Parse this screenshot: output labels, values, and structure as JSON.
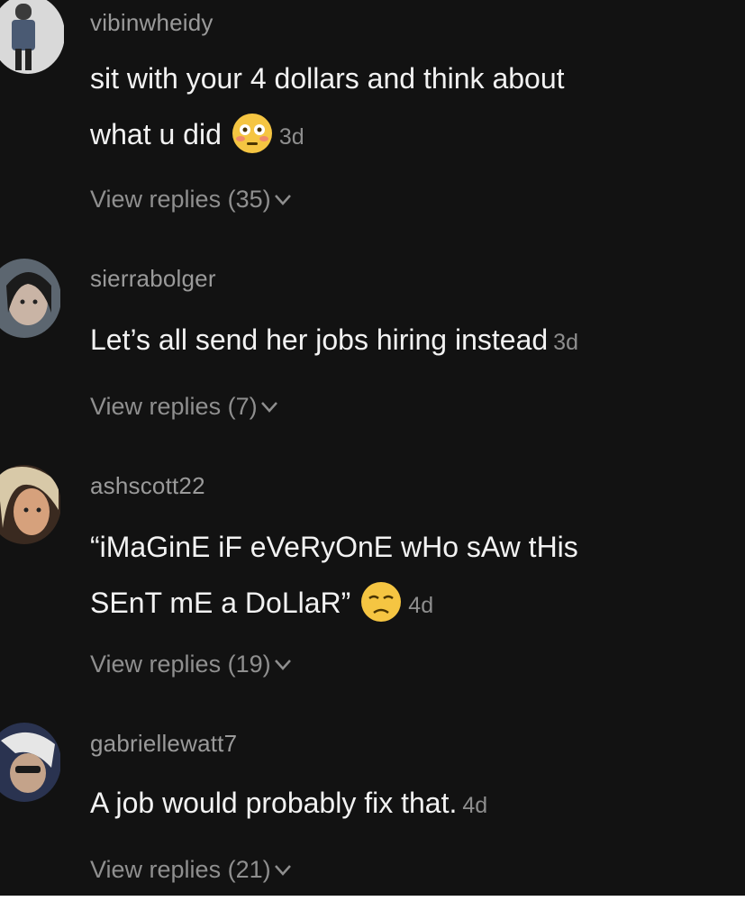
{
  "comments": [
    {
      "username": "vibinwheidy",
      "lines": [
        "sit with your 4 dollars and think about",
        "what u did"
      ],
      "emoji": "flushed-face-emoji",
      "time": "3d",
      "replies_label": "View replies (35)"
    },
    {
      "username": "sierrabolger",
      "lines": [
        "Let’s all send her jobs hiring instead"
      ],
      "time": "3d",
      "replies_label": "View replies (7)"
    },
    {
      "username": "ashscott22",
      "lines": [
        "“iMaGinE iF eVeRyOnE wHo sAw tHis",
        "SEnT mE a DoLlaR”"
      ],
      "emoji": "disappointed-face-emoji",
      "time": "4d",
      "replies_label": "View replies (19)"
    },
    {
      "username": "gabriellewatt7",
      "lines": [
        "A job would probably fix that."
      ],
      "time": "4d",
      "replies_label": "View replies (21)"
    }
  ],
  "colors": {
    "background": "#121212",
    "username": "#9a9a9a",
    "text": "#f2f2f2",
    "muted": "#8f8f8f",
    "emoji": "#f5c542"
  },
  "icons": [
    "chevron-down-icon",
    "avatar"
  ]
}
